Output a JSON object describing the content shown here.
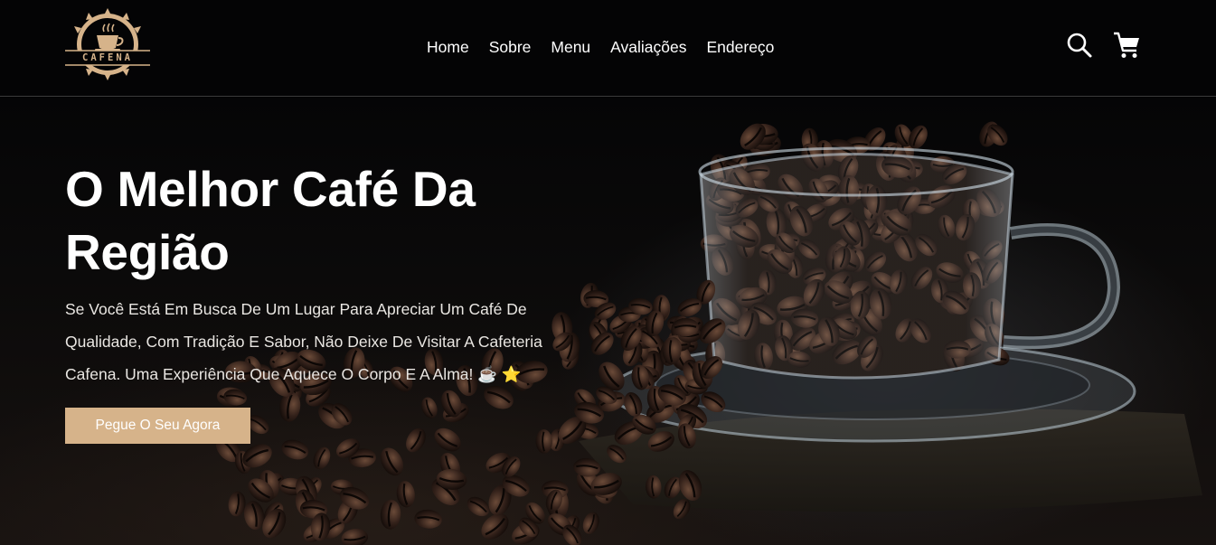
{
  "brand": {
    "logo_text": "CAFENA"
  },
  "nav": {
    "items": [
      {
        "label": "Home"
      },
      {
        "label": "Sobre"
      },
      {
        "label": "Menu"
      },
      {
        "label": "Avaliações"
      },
      {
        "label": "Endereço"
      }
    ]
  },
  "header_icons": {
    "search": "search-icon",
    "cart": "cart-icon"
  },
  "hero": {
    "title": "O Melhor Café Da Região",
    "description": "Se Você Está Em Busca De Um Lugar Para Apreciar Um Café De Qualidade, Com Tradição E Sabor, Não Deixe De Visitar A Cafeteria Cafena. Uma Experiência Que Aquece O Corpo E A Alma! ☕ ⭐",
    "cta_label": "Pegue O Seu Agora"
  },
  "colors": {
    "background": "#030304",
    "accent": "#d6b38a",
    "text": "#ffffff"
  }
}
